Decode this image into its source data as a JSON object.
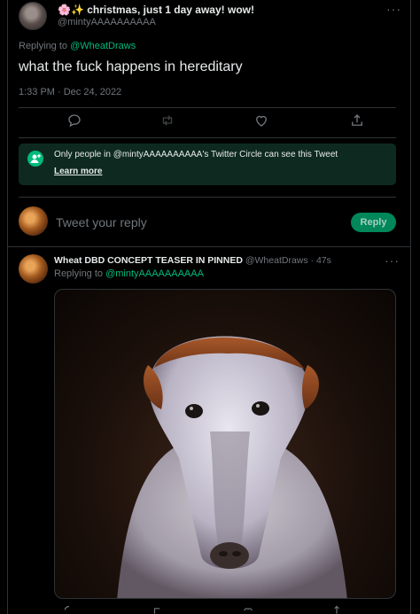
{
  "top_tweet": {
    "name": "christmas, just 1 day away! wow!",
    "name_emoji_1": "🌸",
    "name_emoji_2": "✨",
    "handle": "@mintyAAAAAAAAAA",
    "more": "···",
    "replying_prefix": "Replying to ",
    "replying_to": "@WheatDraws",
    "text": "what the fuck happens in hereditary",
    "timestamp": "1:33 PM · Dec 24, 2022"
  },
  "circle_notice": {
    "text": "Only people in @mintyAAAAAAAAAA's Twitter Circle can see this Tweet",
    "link": "Learn more"
  },
  "reply_box": {
    "placeholder": "Tweet your reply",
    "button": "Reply"
  },
  "second_tweet": {
    "name": "Wheat DBD CONCEPT TEASER IN PINNED",
    "handle_time": "@WheatDraws · 47s",
    "more": "···",
    "replying_prefix": "Replying to ",
    "replying_to": "@mintyAAAAAAAAAA",
    "media_description": "dog-photo"
  },
  "colors": {
    "background": "#000000",
    "accent": "#00ba7c",
    "muted": "#71767b",
    "circle_bg": "#0e2a20"
  },
  "icons": [
    "reply-icon",
    "retweet-icon",
    "like-icon",
    "share-icon",
    "twitter-circle-icon"
  ]
}
